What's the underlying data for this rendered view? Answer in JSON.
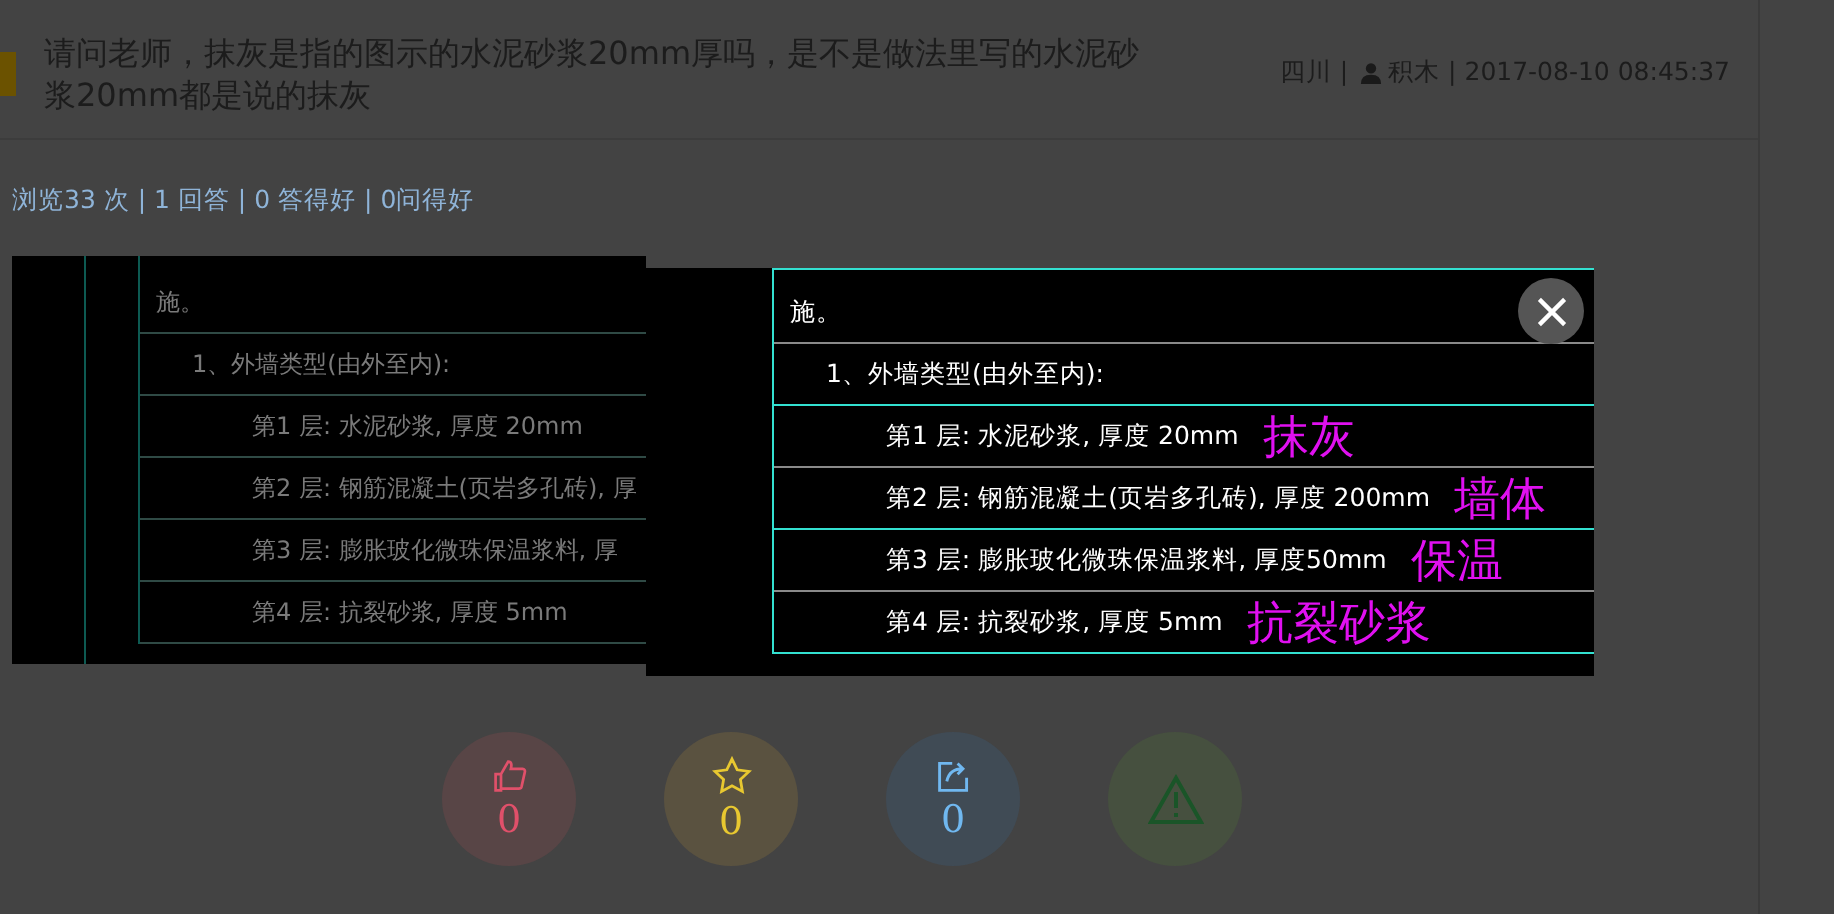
{
  "question": {
    "title": "请问老师，抹灰是指的图示的水泥砂浆20mm厚吗，是不是做法里写的水泥砂浆20mm都是说的抹灰",
    "region": "四川 |",
    "author": "积木 | 2017-08-10 08:45:37"
  },
  "stats": "浏览33 次 | 1 回答 | 0 答得好 | 0问得好",
  "drawing": {
    "lines": [
      {
        "text": "施。"
      },
      {
        "text": "1、外墙类型(由外至内):",
        "children": [
          {
            "text": "第1 层: 水泥砂浆, 厚度 20mm"
          },
          {
            "text": "第2 层: 钢筋混凝土(页岩多孔砖), 厚"
          },
          {
            "text": "第3 层: 膨胀玻化微珠保温浆料, 厚"
          },
          {
            "text": "第4 层: 抗裂砂浆, 厚度 5mm"
          }
        ]
      }
    ]
  },
  "lightbox": {
    "lines": [
      {
        "text": "施。"
      },
      {
        "text": "1、外墙类型(由外至内):",
        "children": [
          {
            "text": "第1 层: 水泥砂浆, 厚度 20mm",
            "note": "抹灰"
          },
          {
            "text": "第2 层: 钢筋混凝土(页岩多孔砖), 厚度  200mm",
            "note": "墙体"
          },
          {
            "text": "第3 层: 膨胀玻化微珠保温浆料, 厚度50mm",
            "note": "保温"
          },
          {
            "text": "第4 层: 抗裂砂浆, 厚度 5mm",
            "note": "抗裂砂浆"
          }
        ]
      }
    ]
  },
  "actions": [
    {
      "kind": "like",
      "count": "0"
    },
    {
      "kind": "star",
      "count": "0"
    },
    {
      "kind": "share",
      "count": "0"
    },
    {
      "kind": "report"
    }
  ]
}
